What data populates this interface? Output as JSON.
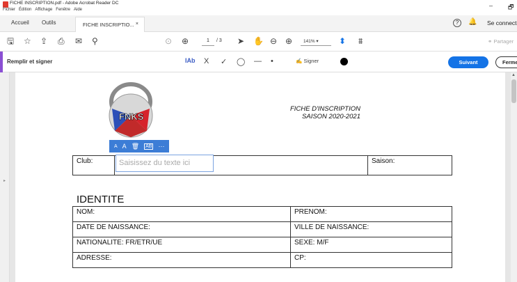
{
  "window": {
    "title": "FICHE INSCRIPTION.pdf - Adobe Acrobat Reader DC",
    "menu": [
      "Fichier",
      "Édition",
      "Affichage",
      "Fenêtre",
      "Aide"
    ],
    "minimize": "–",
    "restore": "🗗"
  },
  "tabs": {
    "home": "Accueil",
    "tools": "Outils",
    "doc": "FICHE INSCRIPTIO...",
    "doc_close": "×",
    "help": "?",
    "bell": "🔔",
    "connect": "Se connecter"
  },
  "toolbar": {
    "page_current": "1",
    "page_total": "/ 3",
    "zoom": "141%",
    "share": "Partager"
  },
  "fill_sign": {
    "label": "Remplir et signer",
    "text_tool": "Ab",
    "sign": "Signer",
    "next": "Suivant",
    "close": "Fermer",
    "ink_color": "#000000",
    "accent_color": "#8a4fd3",
    "next_color": "#1473e6"
  },
  "document": {
    "logo_text": "FNKS",
    "title_line1": "FICHE D'INSCRIPTION",
    "title_line2": "SAISON 2020-2021",
    "club_label": "Club:",
    "saison_label": "Saison:",
    "field_placeholder": "Saisissez du texte ici",
    "section": "IDENTITE",
    "rows": [
      [
        "NOM:",
        "PRENOM:"
      ],
      [
        "DATE DE NAISSANCE:",
        "VILLE DE NAISSANCE:"
      ],
      [
        "NATIONALITE: FR/ETR/UE",
        "SEXE: M/F"
      ],
      [
        "ADRESSE:",
        "CP:"
      ]
    ]
  },
  "field_toolbar": {
    "decrease": "A",
    "increase": "A",
    "delete": "🗑",
    "comb": "AB",
    "more": "···"
  }
}
